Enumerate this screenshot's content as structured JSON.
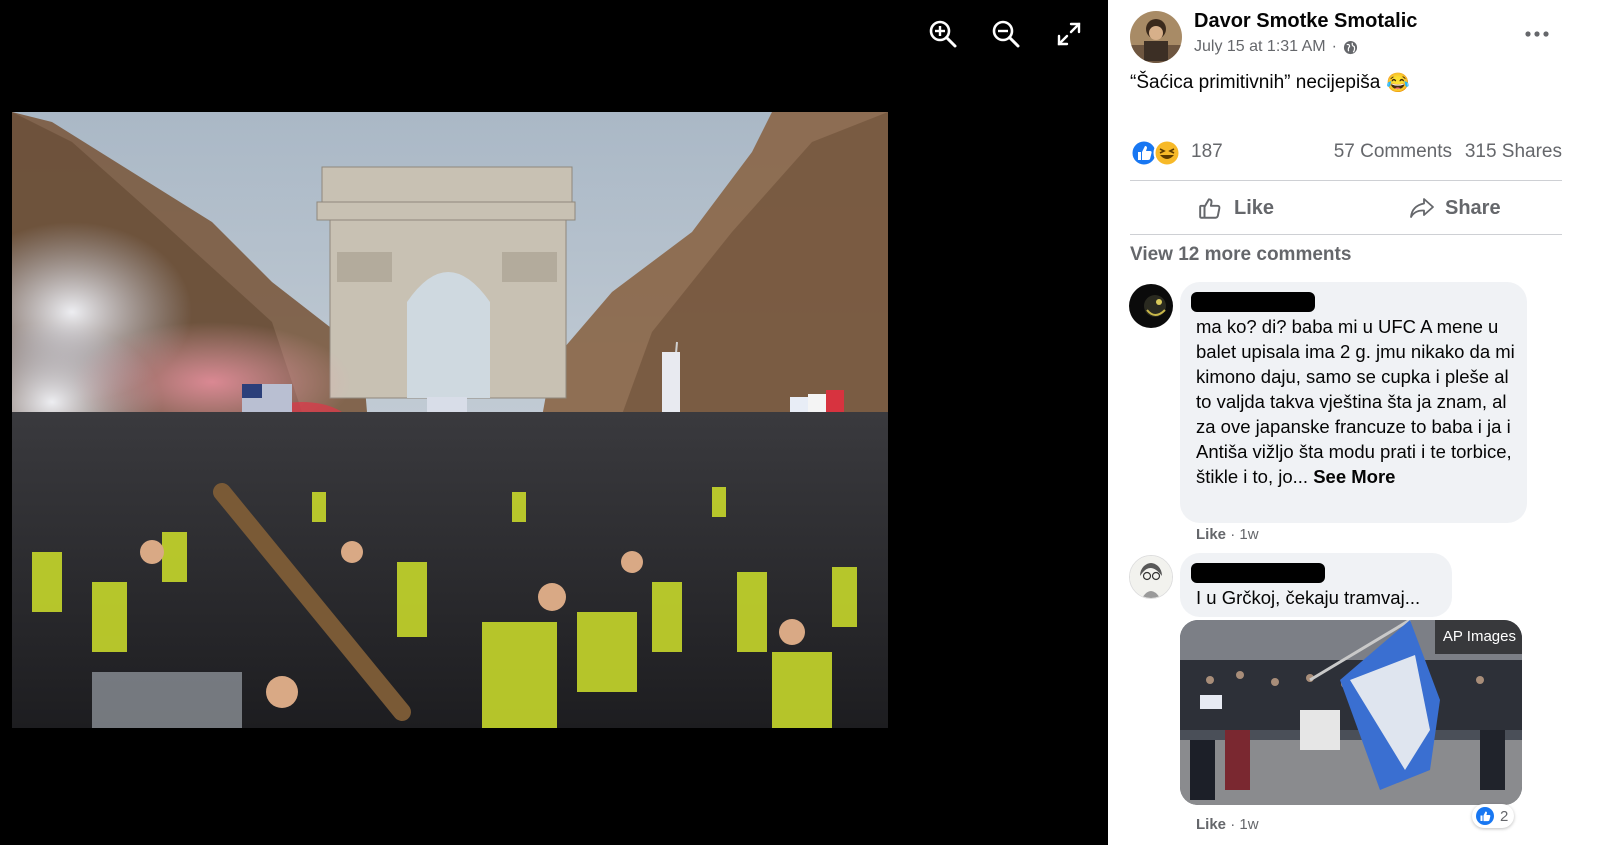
{
  "viewer": {
    "controls": [
      "zoom-in-icon",
      "zoom-out-icon",
      "expand-icon"
    ]
  },
  "post": {
    "author": "Davor Smotke Smotalic",
    "timestamp": "July 15 at 1:31 AM",
    "separator": "·",
    "audience_icon": "globe-icon",
    "caption": "“Šaćica primitivnih” necijepiša",
    "caption_emoji": "😂",
    "reaction_count": "187",
    "comments_count": "57 Comments",
    "shares_count": "315 Shares",
    "like_label": "Like",
    "share_label": "Share"
  },
  "comments_section": {
    "view_more": "View 12 more comments",
    "comments": [
      {
        "text": "ma ko? di? baba mi u UFC A mene u balet upisala ima 2 g. jmu nikako da mi kimono daju, samo se cupka i pleše al to valjda takva vještina šta ja znam, al za ove japanske francuze to baba i ja i Antiša vižljo šta modu prati i te torbice, štikle i to, jo...",
        "see_more": "See More",
        "like_label": "Like",
        "separator": "·",
        "age": "1w"
      },
      {
        "text": "I u Grčkoj, čekaju tramvaj...",
        "image_watermark": "AP Images",
        "like_label": "Like",
        "separator": "·",
        "age": "1w",
        "reaction_count": "2"
      }
    ]
  },
  "colors": {
    "viewer_bg": "#000000",
    "text_primary": "#050505",
    "text_secondary": "#65676b",
    "bubble_bg": "#f0f2f5",
    "like_blue": "#1877f2"
  }
}
